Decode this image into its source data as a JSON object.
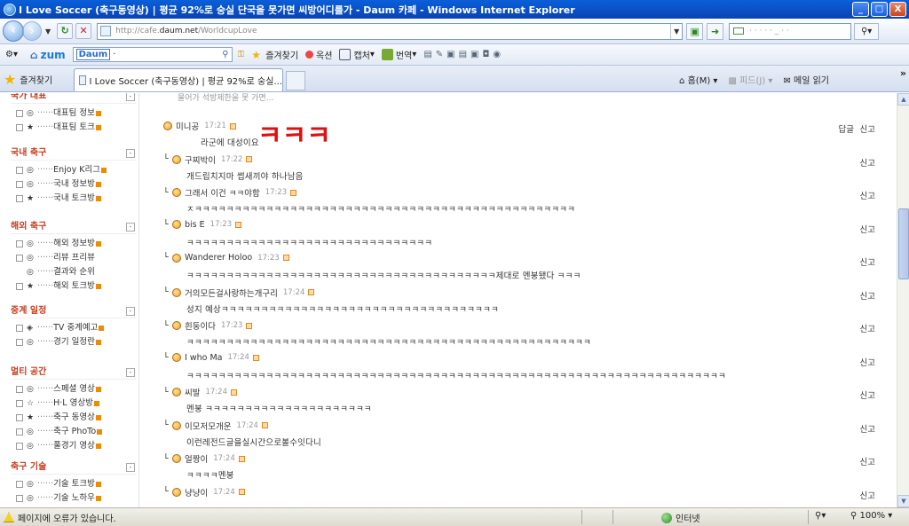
{
  "window": {
    "title": "I Love Soccer (축구동영상) | 평균 92%로 숭실 단국을 못가면 씨방어디를가 - Daum 카페 - Windows Internet Explorer",
    "min": "_",
    "max": "□",
    "close": "X"
  },
  "address": {
    "url_prefix": "http://cafe.",
    "url_host": "daum.net",
    "url_suffix": "/WorldcupLove",
    "search_placeholder": "·  ·  ·  ·  ·  _  ·  ·"
  },
  "toolbar": {
    "zum": "zum",
    "daum_logo": "Daum",
    "items": [
      {
        "label": "즐겨찾기"
      },
      {
        "label": "옥션"
      },
      {
        "label": "캡처"
      },
      {
        "label": "번역"
      }
    ]
  },
  "tabs": {
    "favorites": "즐겨찾기",
    "active_tab": "I Love Soccer (축구동영상) | 평균 92%로 숭실...",
    "home": "홈(M)",
    "feeds": "피드(J)",
    "mail": "메일 읽기"
  },
  "sidebar": {
    "groups": [
      {
        "title": "국가 대표",
        "items": [
          {
            "mark": "◎",
            "label": "대표팀 정보"
          },
          {
            "mark": "★",
            "label": "대표팀 토크"
          }
        ]
      },
      {
        "title": "국내 축구",
        "items": [
          {
            "mark": "◎",
            "label": "Enjoy K리그"
          },
          {
            "mark": "◎",
            "label": "국내 정보방"
          },
          {
            "mark": "★",
            "label": "국내 토크방"
          }
        ]
      },
      {
        "title": "해외 축구",
        "items": [
          {
            "mark": "◎",
            "label": "해외 정보방"
          },
          {
            "mark": "◎",
            "label": "리뷰 프리뷰"
          },
          {
            "mark": "◎",
            "label": "결과와 순위"
          },
          {
            "mark": "★",
            "label": "해외 토크방"
          }
        ]
      },
      {
        "title": "중계 일정",
        "items": [
          {
            "mark": "◈",
            "label": "TV 중계예고"
          },
          {
            "mark": "◎",
            "label": "경기 일정란"
          }
        ]
      },
      {
        "title": "멀티 공간",
        "items": [
          {
            "mark": "◎",
            "label": "스페셜 영상"
          },
          {
            "mark": "☆",
            "label": "H·L 영상방"
          },
          {
            "mark": "★",
            "label": "축구 동영상"
          },
          {
            "mark": "◎",
            "label": "축구 PhoTo"
          },
          {
            "mark": "◎",
            "label": "풀경기 영상"
          }
        ]
      },
      {
        "title": "축구 기술",
        "items": [
          {
            "mark": "◎",
            "label": "기술 토크방"
          },
          {
            "mark": "◎",
            "label": "기술 노하우"
          }
        ]
      }
    ]
  },
  "main": {
    "prev_text": "물어가 석방제한을 못 가면...",
    "annotation": "ㅋㅋㅋ",
    "reply_label": "답글",
    "report_label": "신고",
    "comments": [
      {
        "author": "미니공",
        "time": "17:21",
        "body": "라군에 대성이요"
      },
      {
        "author": "구찌박이",
        "time": "17:22",
        "body": "개드립치지마 썹새끼야 하나남음"
      },
      {
        "author": "그래서 이건 ㅋㅋ야함",
        "time": "17:23",
        "body": "ㅈㅋㅋㅋㅋㅋㅋㅋㅋㅋㅋㅋㅋㅋㅋㅋㅋㅋㅋㅋㅋㅋㅋㅋㅋㅋㅋㅋㅋㅋㅋㅋㅋㅋㅋㅋㅋㅋㅋㅋㅋㅋㅋㅋㅋㅋㅋㅋㅋ"
      },
      {
        "author": "bis E",
        "time": "17:23",
        "body": "ㅋㅋㅋㅋㅋㅋㅋㅋㅋㅋㅋㅋㅋㅋㅋㅋㅋㅋㅋㅋㅋㅋㅋㅋㅋㅋㅋㅋㅋㅋㅋ"
      },
      {
        "author": "Wanderer Holoo",
        "time": "17:23",
        "body": "ㅋㅋㅋㅋㅋㅋㅋㅋㅋㅋㅋㅋㅋㅋㅋㅋㅋㅋㅋㅋㅋㅋㅋㅋㅋㅋㅋㅋㅋㅋㅋㅋㅋㅋㅋㅋㅋㅋㅋ제대로 멘붕됐다 ㅋㅋㅋ"
      },
      {
        "author": "거의모든걸사랑하는개구리",
        "time": "17:24",
        "body": "성지 예상ㅋㅋㅋㅋㅋㅋㅋㅋㅋㅋㅋㅋㅋㅋㅋㅋㅋㅋㅋㅋㅋㅋㅋㅋㅋㅋㅋㅋㅋㅋㅋㅋㅋㅋㅋ"
      },
      {
        "author": "흰둥이다",
        "time": "17:23",
        "body": "ㅋㅋㅋㅋㅋㅋㅋㅋㅋㅋㅋㅋㅋㅋㅋㅋㅋㅋㅋㅋㅋㅋㅋㅋㅋㅋㅋㅋㅋㅋㅋㅋㅋㅋㅋㅋㅋㅋㅋㅋㅋㅋㅋㅋㅋㅋㅋㅋㅋㅋㅋ"
      },
      {
        "author": "I who Ma",
        "time": "17:24",
        "body": "ㅋㅋㅋㅋㅋㅋㅋㅋㅋㅋㅋㅋㅋㅋㅋㅋㅋㅋㅋㅋㅋㅋㅋㅋㅋㅋㅋㅋㅋㅋㅋㅋㅋㅋㅋㅋㅋㅋㅋㅋㅋㅋㅋㅋㅋㅋㅋㅋㅋㅋㅋㅋㅋㅋㅋㅋㅋㅋㅋㅋㅋㅋㅋㅋㅋㅋㅋㅋ"
      },
      {
        "author": "씨발",
        "time": "17:24",
        "body": "멘붕 ㅋㅋㅋㅋㅋㅋㅋㅋㅋㅋㅋㅋㅋㅋㅋㅋㅋㅋㅋㅋㅋ"
      },
      {
        "author": "이모저모개운",
        "time": "17:24",
        "body": "이런레전드글을실시간으로볼수잇다니"
      },
      {
        "author": "얼짱이",
        "time": "17:24",
        "body": "ㅋㅋㅋㅋ멘붕"
      },
      {
        "author": "냥냥이",
        "time": "17:24",
        "body": ""
      }
    ]
  },
  "status": {
    "message": "페이지에 오류가 있습니다.",
    "zone": "인터넷",
    "zoom": "100%"
  }
}
